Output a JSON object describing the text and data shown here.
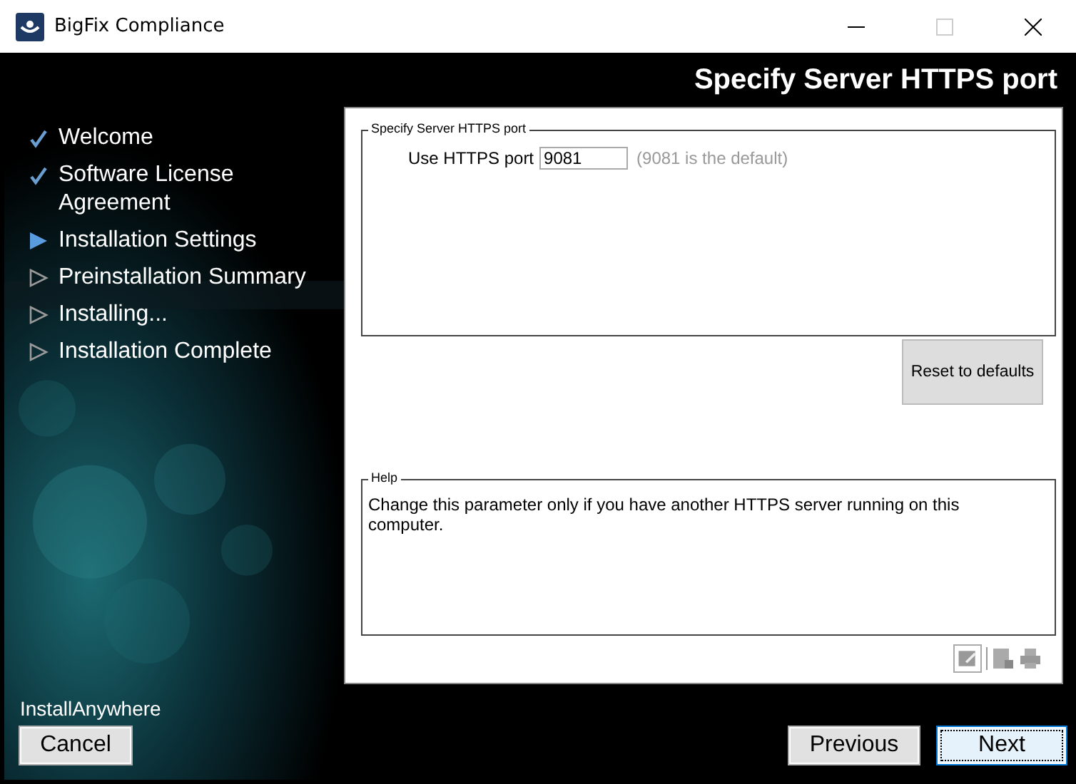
{
  "window": {
    "title": "BigFix Compliance"
  },
  "header": {
    "title": "Specify Server HTTPS port"
  },
  "steps": [
    {
      "label": "Welcome",
      "kind": "done"
    },
    {
      "label": "Software License Agreement",
      "kind": "done"
    },
    {
      "label": "Installation Settings",
      "kind": "current"
    },
    {
      "label": "Preinstallation Summary",
      "kind": "pending"
    },
    {
      "label": "Installing...",
      "kind": "pending"
    },
    {
      "label": "Installation Complete",
      "kind": "pending"
    }
  ],
  "settings": {
    "legend": "Specify Server HTTPS port",
    "label": "Use HTTPS port",
    "value": "9081",
    "hint": "(9081 is the default)"
  },
  "reset_button": "Reset to defaults",
  "help": {
    "legend": "Help",
    "text": "Change this parameter only if you have another HTTPS server running on this computer."
  },
  "brand": "InstallAnywhere",
  "buttons": [
    {
      "label": "Cancel",
      "selected": false
    },
    {
      "label": "Previous",
      "selected": false
    },
    {
      "label": "Next",
      "selected": true
    }
  ]
}
